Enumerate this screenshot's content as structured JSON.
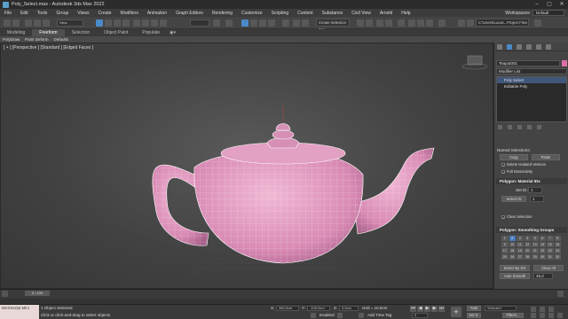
{
  "app": {
    "title": "Poly_Select.max - Autodesk 3ds Max 2022",
    "window_controls": [
      "–",
      "▢",
      "✕"
    ]
  },
  "menu": {
    "items": [
      "File",
      "Edit",
      "Tools",
      "Group",
      "Views",
      "Create",
      "Modifiers",
      "Animation",
      "Graph Editors",
      "Rendering",
      "Customize",
      "Scripting",
      "Content",
      "Substance",
      "Civil View",
      "Arnold",
      "Help"
    ],
    "workspace_label": "Workspaces:",
    "workspace_value": "Default"
  },
  "toolbar": {
    "filter_dropdown": "View",
    "selection_set_placeholder": "Create Selection Set",
    "project_path": "C:\\Users\\Lucas...Project Files"
  },
  "ribbon": {
    "tabs": [
      "Modeling",
      "Freeform",
      "Selection",
      "Object Paint",
      "Populate"
    ],
    "active_tab": "Freeform",
    "subtabs": [
      "PolyDraw",
      "Paint Deform",
      "Defaults"
    ]
  },
  "viewport": {
    "label": "[ + ] [Perspective ] [Standard ] [Edged Faces ]",
    "object_color": "#e6a3c6",
    "wire_color": "#ffffff",
    "gizmo_color": "#e04040"
  },
  "command_panel": {
    "object_name": "Teapot001",
    "object_color": "#e070a8",
    "modifier_list": "Modifier List",
    "stack": [
      "Poly Select",
      "Editable Poly"
    ],
    "stack_selected": "Poly Select",
    "named_selections_label": "Named Selections:",
    "copy": "Copy",
    "paste": "Paste",
    "delete_isolated": "Delete Isolated Vertices",
    "full_interactivity": "Full Interactivity",
    "material_ids_header": "Polygon: Material IDs",
    "set_id": "Set ID:",
    "set_id_value": "1",
    "select_id": "Select ID",
    "select_id_value": "1",
    "clear_selection": "Clear Selection",
    "smoothing_header": "Polygon: Smoothing Groups",
    "smoothing_groups": [
      "1",
      "2",
      "3",
      "4",
      "5",
      "6",
      "7",
      "8",
      "9",
      "10",
      "11",
      "12",
      "13",
      "14",
      "15",
      "16",
      "17",
      "18",
      "19",
      "20",
      "21",
      "22",
      "23",
      "24",
      "25",
      "26",
      "27",
      "28",
      "29",
      "30",
      "31",
      "32"
    ],
    "smoothing_on": [
      "2"
    ],
    "select_by_sg": "Select By SG",
    "clear_all": "Clear All",
    "auto_smooth": "Auto Smooth",
    "auto_smooth_value": "45,0"
  },
  "timeline": {
    "frame": "0 / 100"
  },
  "status": {
    "maxscript": "MAXScript Mini",
    "selected": "1 Object Selected",
    "prompt": "Click or click-and-drag to select objects",
    "x_label": "X:",
    "x_value": "389,0cm",
    "y_label": "Y:",
    "y_value": "-105,0cm",
    "z_label": "Z:",
    "z_value": "0,0cm",
    "grid": "Grid = 10,0cm",
    "enabled": "Enabled:",
    "add_time_tag": "Add Time Tag",
    "auto": "Auto",
    "selected_dd": "Selected",
    "set_k": "Set K.",
    "filters": "Filters...",
    "frame_value": "0"
  }
}
